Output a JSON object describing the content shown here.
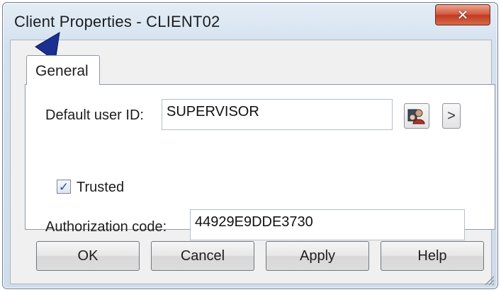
{
  "window": {
    "title": "Client Properties - CLIENT02",
    "close_icon": "close-icon"
  },
  "tabs": [
    {
      "label": "General",
      "selected": true
    }
  ],
  "general": {
    "default_user_id_label": "Default user ID:",
    "default_user_id_value": "SUPERVISOR",
    "browse_users_icon": "users-lookup-icon",
    "more_button_glyph": ">",
    "trusted_label": "Trusted",
    "trusted_checked": true,
    "authorization_code_label": "Authorization code:",
    "authorization_code_value": "44929E9DDE3730"
  },
  "buttons": {
    "ok": "OK",
    "cancel": "Cancel",
    "apply": "Apply",
    "help": "Help"
  },
  "colors": {
    "close_button": "#d3573e",
    "cursor_arrow": "#1a2f8f"
  }
}
